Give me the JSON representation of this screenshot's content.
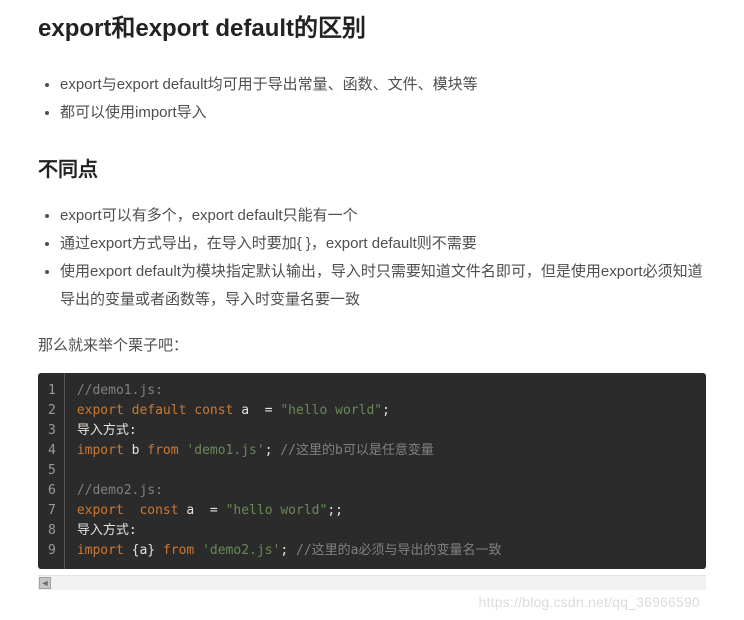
{
  "title": "export和export default的区别",
  "similar": [
    "export与export default均可用于导出常量、函数、文件、模块等",
    "都可以使用import导入"
  ],
  "diff_heading": "不同点",
  "differences": [
    "export可以有多个，export default只能有一个",
    "通过export方式导出，在导入时要加{ }，export default则不需要",
    "使用export default为模块指定默认输出，导入时只需要知道文件名即可，但是使用export必须知道导出的变量或者函数等，导入时变量名要一致"
  ],
  "example_lead": "那么就来举个栗子吧：",
  "code": {
    "lines": [
      {
        "n": 1,
        "tokens": [
          [
            "cm",
            "//demo1.js:"
          ]
        ]
      },
      {
        "n": 2,
        "tokens": [
          [
            "kw",
            "export"
          ],
          [
            "pl",
            " "
          ],
          [
            "kw",
            "default"
          ],
          [
            "pl",
            " "
          ],
          [
            "kw",
            "const"
          ],
          [
            "pl",
            " a  "
          ],
          [
            "op",
            "="
          ],
          [
            "pl",
            " "
          ],
          [
            "str",
            "\"hello world\""
          ],
          [
            "op",
            ";"
          ]
        ]
      },
      {
        "n": 3,
        "tokens": [
          [
            "pl",
            "导入方式:"
          ]
        ]
      },
      {
        "n": 4,
        "tokens": [
          [
            "kw",
            "import"
          ],
          [
            "pl",
            " b "
          ],
          [
            "kw",
            "from"
          ],
          [
            "pl",
            " "
          ],
          [
            "str",
            "'demo1.js'"
          ],
          [
            "op",
            ";"
          ],
          [
            "pl",
            " "
          ],
          [
            "cm",
            "//这里的b可以是任意变量"
          ]
        ]
      },
      {
        "n": 5,
        "tokens": [
          [
            "pl",
            " "
          ]
        ]
      },
      {
        "n": 6,
        "tokens": [
          [
            "cm",
            "//demo2.js:"
          ]
        ]
      },
      {
        "n": 7,
        "tokens": [
          [
            "kw",
            "export"
          ],
          [
            "pl",
            "  "
          ],
          [
            "kw",
            "const"
          ],
          [
            "pl",
            " a  "
          ],
          [
            "op",
            "="
          ],
          [
            "pl",
            " "
          ],
          [
            "str",
            "\"hello world\""
          ],
          [
            "op",
            ";;"
          ]
        ]
      },
      {
        "n": 8,
        "tokens": [
          [
            "pl",
            "导入方式:"
          ]
        ]
      },
      {
        "n": 9,
        "tokens": [
          [
            "kw",
            "import"
          ],
          [
            "pl",
            " "
          ],
          [
            "op",
            "{"
          ],
          [
            "pl",
            "a"
          ],
          [
            "op",
            "}"
          ],
          [
            "pl",
            " "
          ],
          [
            "kw",
            "from"
          ],
          [
            "pl",
            " "
          ],
          [
            "str",
            "'demo2.js'"
          ],
          [
            "op",
            ";"
          ],
          [
            "pl",
            " "
          ],
          [
            "cm",
            "//这里的a必须与导出的变量名一致"
          ]
        ]
      }
    ]
  },
  "scroll_left_glyph": "◄",
  "watermark": "https://blog.csdn.net/qq_36966590"
}
